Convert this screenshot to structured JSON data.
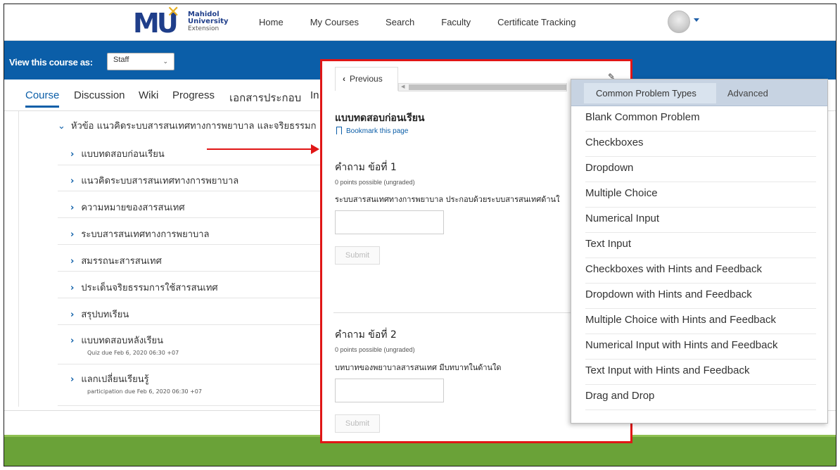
{
  "nav": {
    "logo": {
      "line1": "Mahidol",
      "line2": "University",
      "line3": "Extension"
    },
    "links": [
      "Home",
      "My Courses",
      "Search",
      "Faculty",
      "Certificate Tracking"
    ]
  },
  "view_as": {
    "label": "View this course as:",
    "selected": "Staff"
  },
  "tabs": [
    {
      "label": "Course"
    },
    {
      "label": "Discussion"
    },
    {
      "label": "Wiki"
    },
    {
      "label": "Progress"
    },
    {
      "label": "เอกสารประกอบ"
    },
    {
      "label": "In"
    }
  ],
  "outline": {
    "section": "หัวข้อ แนวคิดระบบสารสนเทศทางการพยาบาล และจริยธรรมก",
    "items": [
      {
        "label": "แบบทดสอบก่อนเรียน",
        "meta": ""
      },
      {
        "label": "แนวคิดระบบสารสนเทศทางการพยาบาล",
        "meta": ""
      },
      {
        "label": "ความหมายของสารสนเทศ",
        "meta": ""
      },
      {
        "label": "ระบบสารสนเทศทางการพยาบาล",
        "meta": ""
      },
      {
        "label": "สมรรถนะสารสนเทศ",
        "meta": ""
      },
      {
        "label": "ประเด็นจริยธรรมการใช้สารสนเทศ",
        "meta": ""
      },
      {
        "label": "สรุปบทเรียน",
        "meta": ""
      },
      {
        "label": "แบบทดสอบหลังเรียน",
        "meta": "Quiz due Feb 6, 2020 06:30 +07"
      },
      {
        "label": "แลกเปลี่ยนเรียนรู้",
        "meta": "participation due Feb 6, 2020 06:30 +07"
      }
    ]
  },
  "unit": {
    "previous_label": "Previous",
    "title": "แบบทดสอบก่อนเรียน",
    "bookmark": "Bookmark this page",
    "questions": [
      {
        "title": "คำถาม ข้อที่ 1",
        "points": "0 points possible (ungraded)",
        "text": "ระบบสารสนเทศทางการพยาบาล ประกอบด้วยระบบสารสนเทศด้านใ",
        "submit": "Submit"
      },
      {
        "title": "คำถาม ข้อที่ 2",
        "points": "0 points possible (ungraded)",
        "text": "บทบาทของพยาบาลสารสนเทศ มีบทบาทในด้านใด",
        "submit": "Submit"
      }
    ]
  },
  "problem_menu": {
    "tabs": [
      "Common Problem Types",
      "Advanced"
    ],
    "items": [
      "Blank Common Problem",
      "Checkboxes",
      "Dropdown",
      "Multiple Choice",
      "Numerical Input",
      "Text Input",
      "Checkboxes with Hints and Feedback",
      "Dropdown with Hints and Feedback",
      "Multiple Choice with Hints and Feedback",
      "Numerical Input with Hints and Feedback",
      "Text Input with Hints and Feedback",
      "Drag and Drop"
    ]
  },
  "colors": {
    "brand_blue": "#0b5ea8",
    "highlight_red": "#e01616",
    "footer_green": "#6aa238"
  }
}
